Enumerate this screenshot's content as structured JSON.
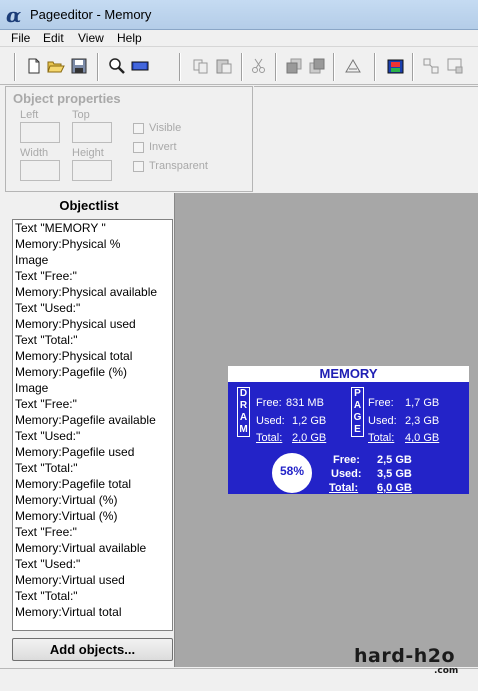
{
  "window": {
    "title": "Pageeditor - Memory",
    "logo_glyph": "α"
  },
  "menu": {
    "file": "File",
    "edit": "Edit",
    "view": "View",
    "help": "Help"
  },
  "toolbar": {
    "icons": [
      "new-icon",
      "open-icon",
      "save-icon",
      "zoom-icon",
      "grid-icon",
      "copy-icon",
      "paste-icon",
      "cut-icon",
      "bring-front-icon",
      "send-back-icon",
      "properties-icon",
      "export-icon",
      "align-icon",
      "resize-icon"
    ]
  },
  "object_properties": {
    "caption": "Object properties",
    "left_label": "Left",
    "top_label": "Top",
    "width_label": "Width",
    "height_label": "Height",
    "visible_label": "Visible",
    "invert_label": "Invert",
    "transparent_label": "Transparent"
  },
  "objectlist": {
    "header": "Objectlist",
    "items": [
      "Text \"MEMORY \"",
      "Memory:Physical %",
      "Image",
      "Text \"Free:\"",
      "Memory:Physical available",
      "Text \"Used:\"",
      "Memory:Physical used",
      "Text \"Total:\"",
      "Memory:Physical total",
      "Memory:Pagefile (%)",
      "Image",
      "Text \"Free:\"",
      "Memory:Pagefile available",
      "Text \"Used:\"",
      "Memory:Pagefile used",
      "Text \"Total:\"",
      "Memory:Pagefile total",
      "Memory:Virtual (%)",
      "Memory:Virtual (%)",
      "Text \"Free:\"",
      "Memory:Virtual available",
      "Text \"Used:\"",
      "Memory:Virtual used",
      "Text \"Total:\"",
      "Memory:Virtual total"
    ],
    "add_button": "Add objects..."
  },
  "preview": {
    "title": "MEMORY",
    "dram_letters": [
      "D",
      "R",
      "A",
      "M"
    ],
    "page_letters": [
      "P",
      "A",
      "G",
      "E"
    ],
    "physical": {
      "free_label": "Free:",
      "free": "831 MB",
      "used_label": "Used:",
      "used": "1,2 GB",
      "total_label": "Total:",
      "total": "2,0 GB"
    },
    "pagefile": {
      "free_label": "Free:",
      "free": "1,7 GB",
      "used_label": "Used:",
      "used": "2,3 GB",
      "total_label": "Total:",
      "total": "4,0 GB"
    },
    "virtual": {
      "free_label": "Free:",
      "free": "2,5 GB",
      "used_label": "Used:",
      "used": "3,5 GB",
      "total_label": "Total:",
      "total": "6,0 GB"
    },
    "gauge_text": "58%",
    "colors": {
      "panel_bg": "#2323c8",
      "title_bg": "#ffffff",
      "text": "#ffffff"
    }
  },
  "watermark": {
    "main": "hard-h2o",
    "sub": ".com"
  }
}
